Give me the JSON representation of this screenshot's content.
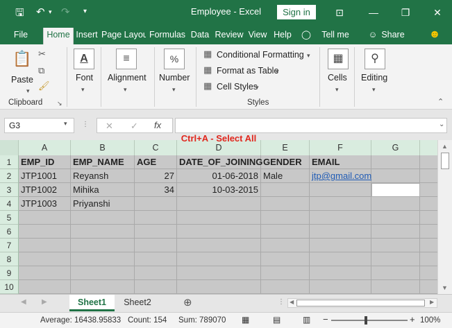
{
  "window": {
    "title": "Employee  -  Excel",
    "sign_in": "Sign in",
    "minimize": "—",
    "restore": "❐",
    "close": "✕",
    "ribbon_display": "⊡"
  },
  "tabs": [
    "File",
    "Home",
    "Insert",
    "Page Layou",
    "Formulas",
    "Data",
    "Review",
    "View",
    "Help"
  ],
  "active_tab": "Home",
  "tell_me": "Tell me",
  "share": "Share",
  "ribbon": {
    "clipboard": {
      "paste": "Paste",
      "label": "Clipboard"
    },
    "font": {
      "label": "Font"
    },
    "alignment": {
      "label": "Alignment"
    },
    "number": {
      "label": "Number",
      "icon_text": "%"
    },
    "styles": {
      "conditional_formatting": "Conditional Formatting",
      "format_as_table": "Format as Table",
      "cell_styles": "Cell Styles",
      "label": "Styles"
    },
    "cells": {
      "label": "Cells"
    },
    "editing": {
      "label": "Editing"
    }
  },
  "formula_bar": {
    "name_box": "G3",
    "formula": "",
    "fx": "fx"
  },
  "annotation": "Ctrl+A - Select All",
  "columns": [
    "A",
    "B",
    "C",
    "D",
    "E",
    "F",
    "G"
  ],
  "rows": [
    "1",
    "2",
    "3",
    "4",
    "5",
    "6",
    "7",
    "8",
    "9",
    "10"
  ],
  "headers": [
    "EMP_ID",
    "EMP_NAME",
    "AGE",
    "DATE_OF_JOINING",
    "GENDER",
    "EMAIL"
  ],
  "data_rows": [
    [
      "JTP1001",
      "Reyansh",
      "27",
      "01-06-2018",
      "Male",
      "jtp@gmail.com"
    ],
    [
      "JTP1002",
      "Mihika",
      "34",
      "10-03-2015",
      "",
      ""
    ],
    [
      "JTP1003",
      "Priyanshi",
      "",
      "",
      "",
      ""
    ]
  ],
  "sheets": [
    "Sheet1",
    "Sheet2"
  ],
  "active_sheet": "Sheet1",
  "status": {
    "average": "Average: 16438.95833",
    "count": "Count: 154",
    "sum": "Sum: 789070",
    "zoom": "100%",
    "zoom_minus": "−",
    "zoom_plus": "+"
  },
  "colors": {
    "excel_green": "#217346",
    "selection_gray": "#c8c8c8",
    "annotation_red": "#e0261c",
    "link_blue": "#1f5bb5"
  }
}
